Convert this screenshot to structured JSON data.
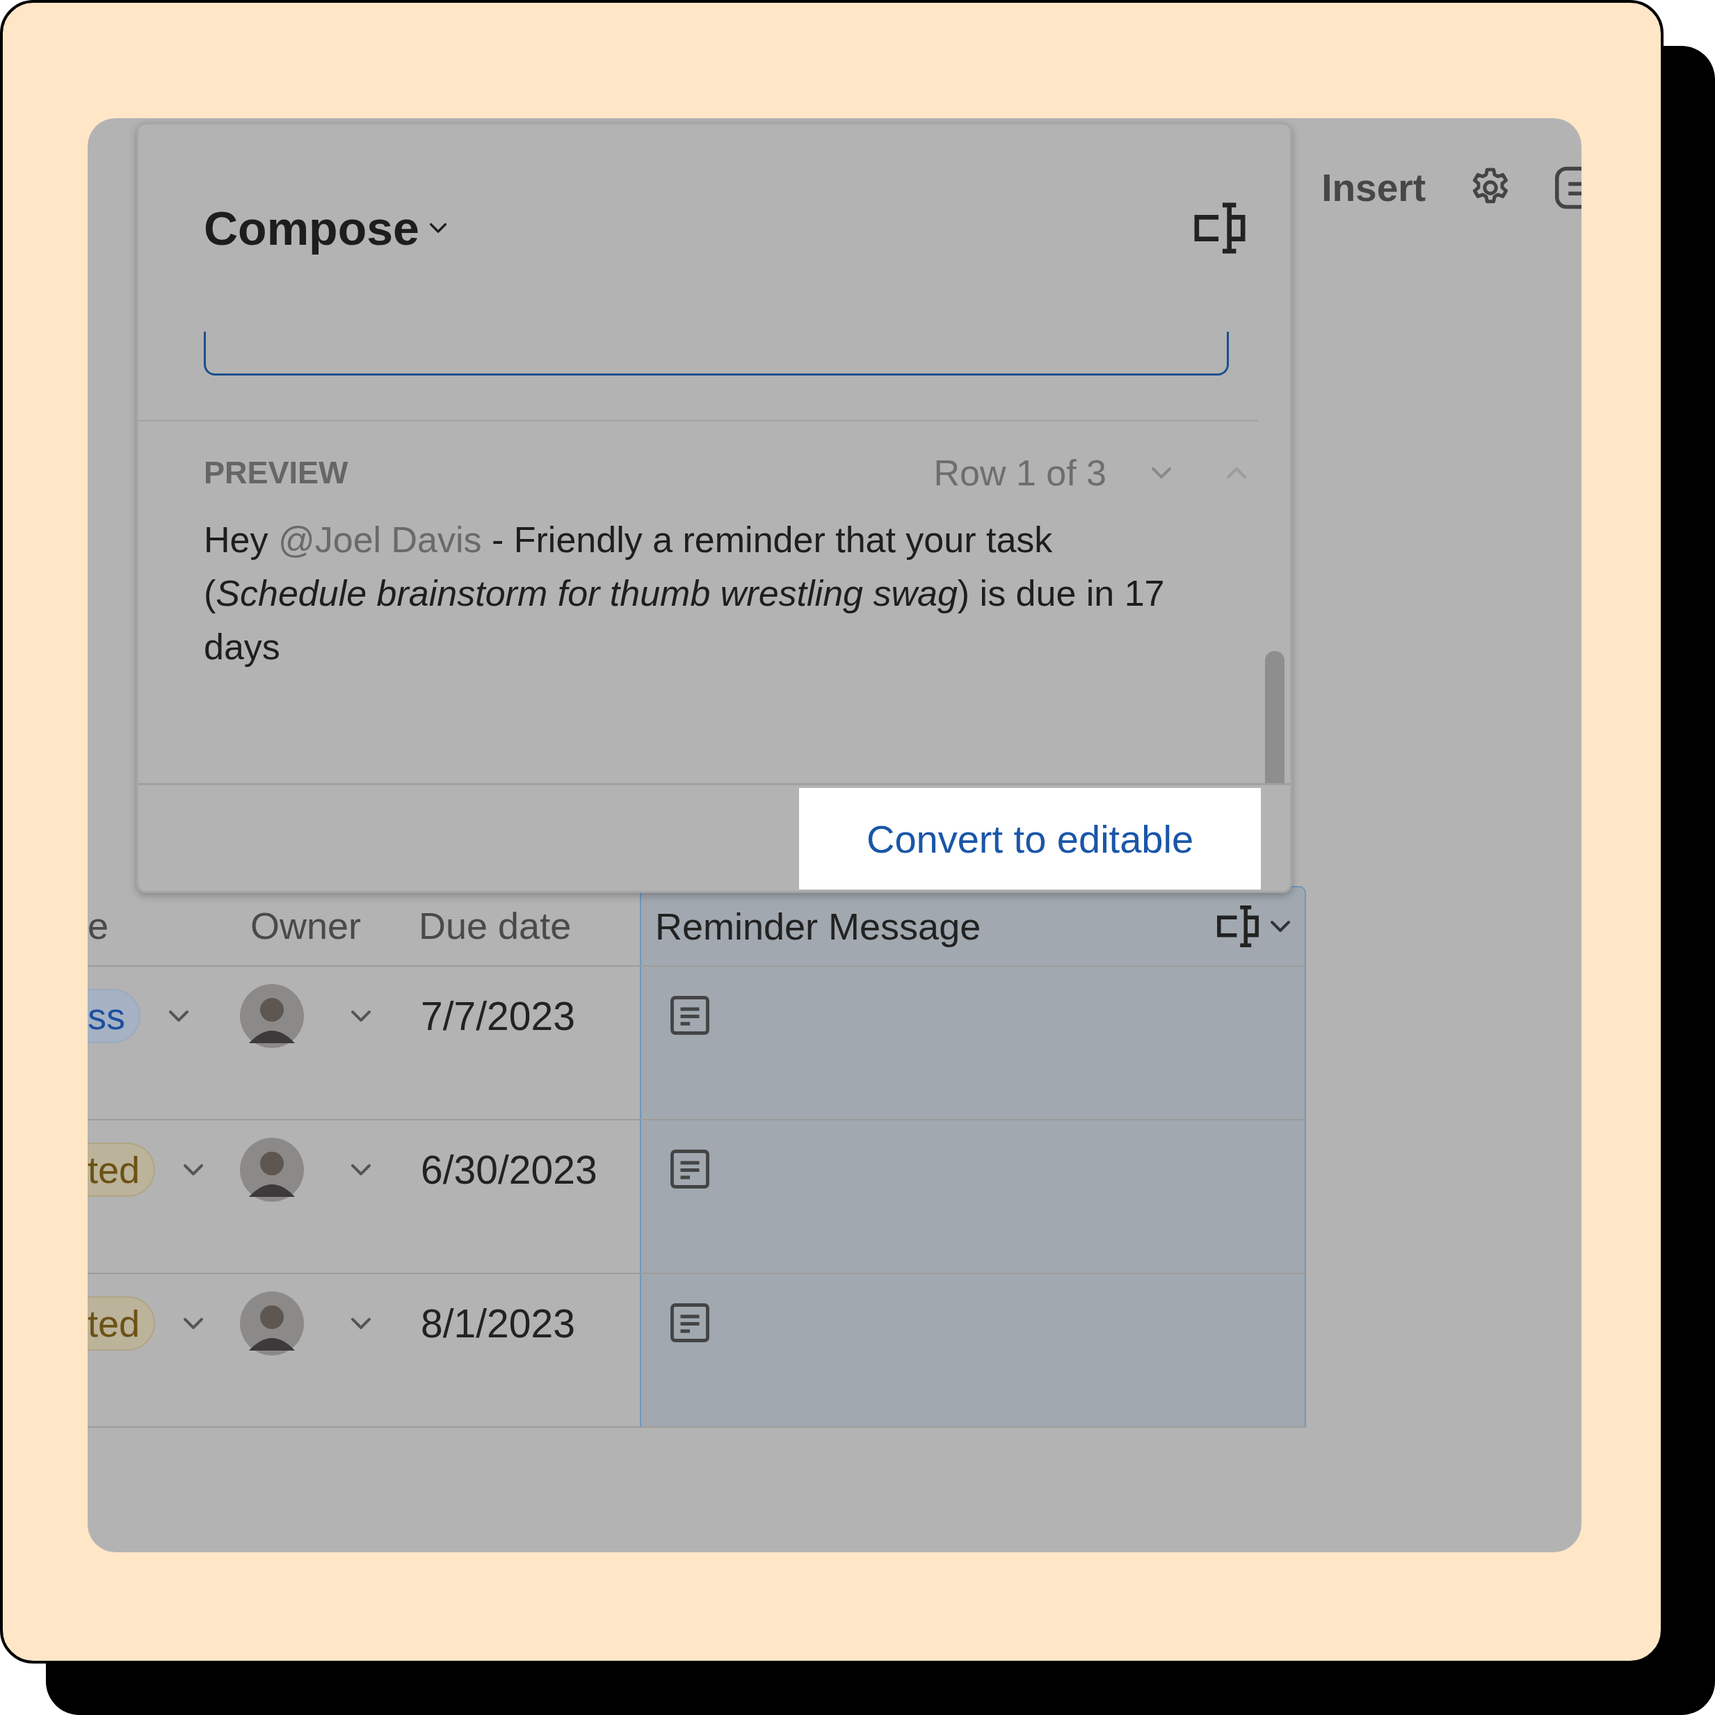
{
  "toolbar": {
    "insert_label": "Insert"
  },
  "popover": {
    "title": "Compose",
    "preview_label": "PREVIEW",
    "row_indicator": "Row 1 of 3",
    "message": [
      {
        "kind": "plain",
        "text": "Hey "
      },
      {
        "kind": "mention",
        "text": "@Joel Davis"
      },
      {
        "kind": "plain",
        "text": " - Friendly a reminder that your task (*Schedule brainstorm for thumb wrestling swag*) is due in 17 days"
      }
    ],
    "convert_button": "Convert to editable"
  },
  "table": {
    "columns": [
      "e",
      "Owner",
      "Due date",
      "Reminder Message"
    ],
    "rows": [
      {
        "status": "ss",
        "color": "#1d4fa0",
        "due_date": "7/7/2023"
      },
      {
        "status": "ted",
        "color": "#6b5214",
        "due_date": "6/30/2023"
      },
      {
        "status": "ted",
        "color": "#6b5214",
        "due_date": "8/1/2023"
      }
    ]
  }
}
